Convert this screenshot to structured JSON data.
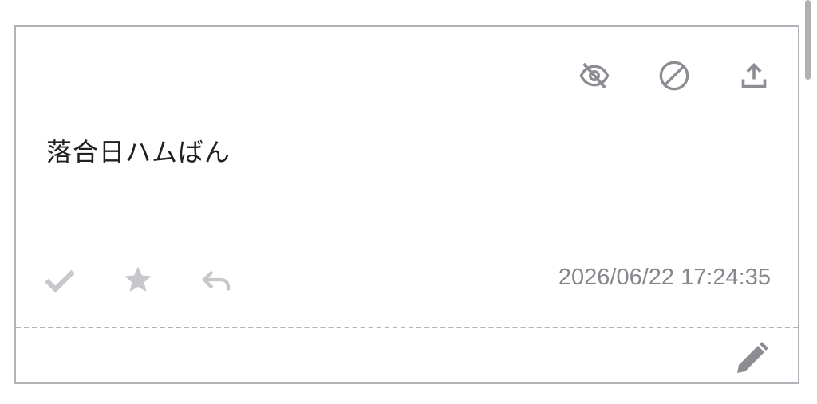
{
  "card": {
    "title": "落合日ハムばん",
    "timestamp": "2026/06/22 17:24:35",
    "top_actions": [
      {
        "icon": "eye-off-icon"
      },
      {
        "icon": "block-icon"
      },
      {
        "icon": "upload-icon"
      }
    ],
    "bottom_actions": [
      {
        "icon": "check-icon"
      },
      {
        "icon": "star-icon"
      },
      {
        "icon": "reply-icon"
      }
    ],
    "edit_icon": "pencil-icon"
  },
  "colors": {
    "icon_dark": "#8c8c92",
    "icon_light": "#c8c8cc",
    "border": "#b2b2b8",
    "text": "#202020",
    "timestamp": "#86868c"
  }
}
